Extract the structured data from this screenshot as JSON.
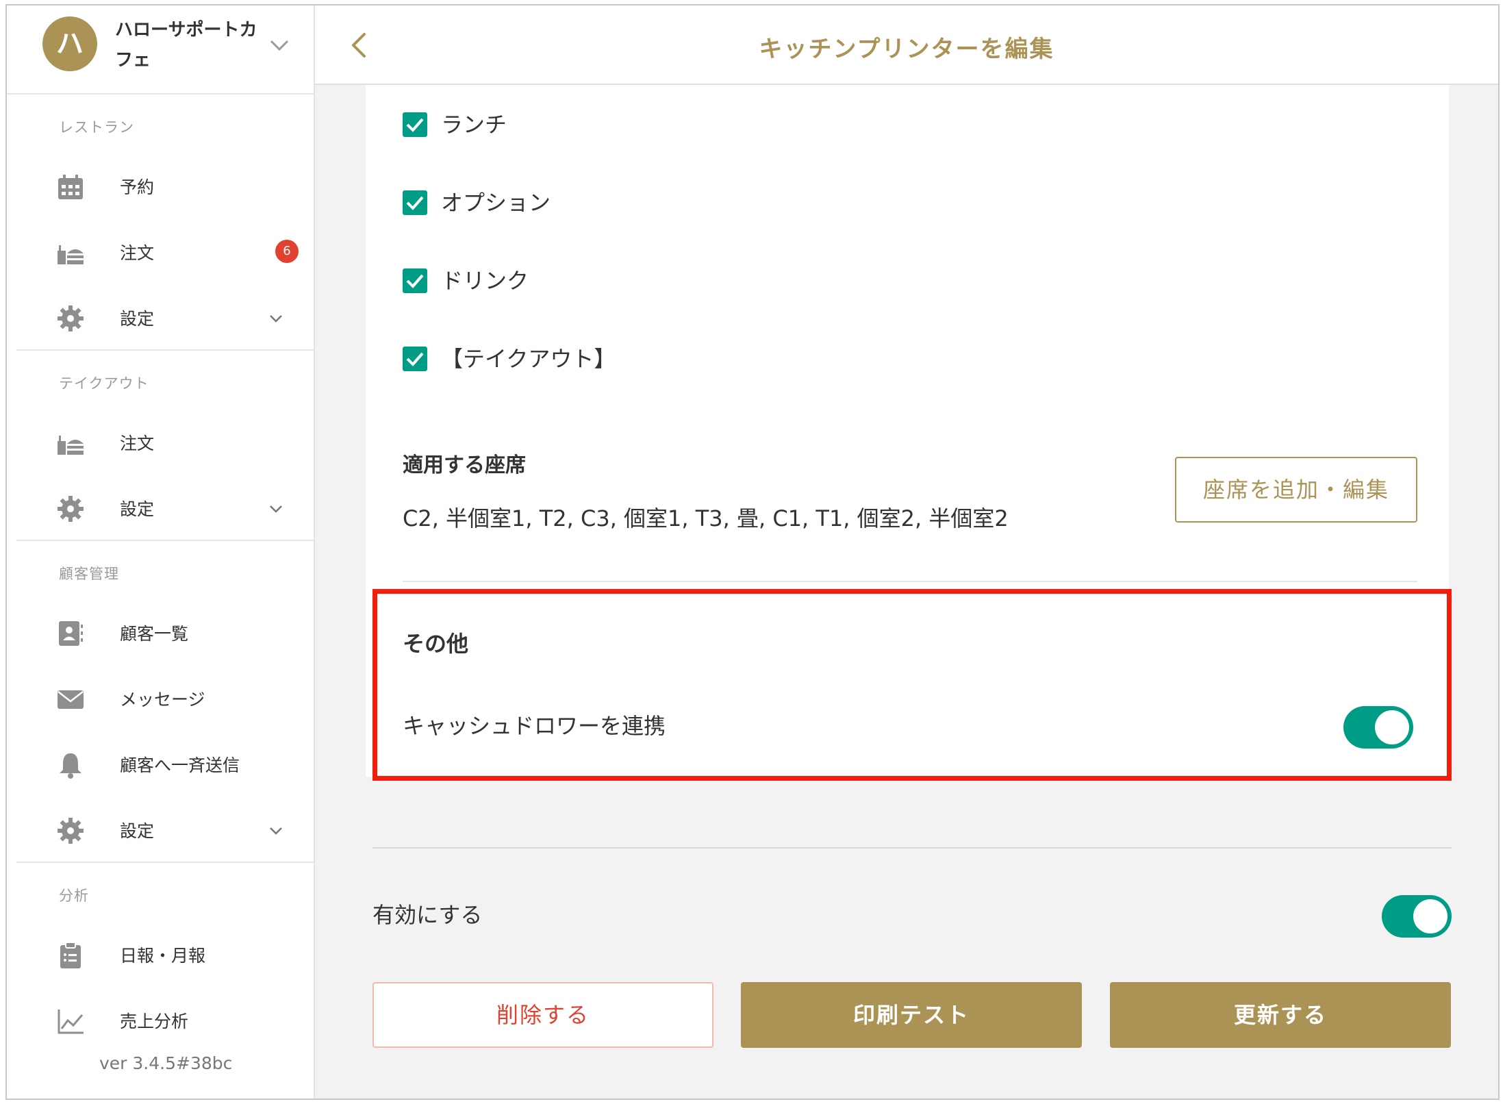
{
  "account": {
    "avatar_initial": "ハ",
    "name": "ハローサポートカフェ"
  },
  "sidebar": {
    "sections": [
      {
        "label": "レストラン",
        "items": [
          {
            "label": "予約",
            "icon": "calendar-icon"
          },
          {
            "label": "注文",
            "icon": "order-tray-icon",
            "badge": "6"
          },
          {
            "label": "設定",
            "icon": "gear-icon",
            "expandable": true
          }
        ]
      },
      {
        "label": "テイクアウト",
        "items": [
          {
            "label": "注文",
            "icon": "order-tray-icon"
          },
          {
            "label": "設定",
            "icon": "gear-icon",
            "expandable": true
          }
        ]
      },
      {
        "label": "顧客管理",
        "items": [
          {
            "label": "顧客一覧",
            "icon": "contact-book-icon"
          },
          {
            "label": "メッセージ",
            "icon": "envelope-icon"
          },
          {
            "label": "顧客へ一斉送信",
            "icon": "bell-icon"
          },
          {
            "label": "設定",
            "icon": "gear-icon",
            "expandable": true
          }
        ]
      },
      {
        "label": "分析",
        "items": [
          {
            "label": "日報・月報",
            "icon": "clipboard-icon"
          },
          {
            "label": "売上分析",
            "icon": "line-chart-icon"
          }
        ]
      }
    ],
    "version": "ver 3.4.5#38bc"
  },
  "header": {
    "title": "キッチンプリンターを編集"
  },
  "categories": [
    {
      "label": "ランチ",
      "checked": true
    },
    {
      "label": "オプション",
      "checked": true
    },
    {
      "label": "ドリンク",
      "checked": true
    },
    {
      "label": "【テイクアウト】",
      "checked": true
    }
  ],
  "seats": {
    "title": "適用する座席",
    "list": "C2, 半個室1, T2, C3, 個室1, T3, 畳, C1, T1, 個室2, 半個室2",
    "edit_button": "座席を追加・編集"
  },
  "other": {
    "title": "その他",
    "cash_drawer_label": "キャッシュドロワーを連携",
    "cash_drawer_enabled": true
  },
  "enable": {
    "label": "有効にする",
    "enabled": true
  },
  "actions": {
    "delete": "削除する",
    "print_test": "印刷テスト",
    "update": "更新する"
  },
  "colors": {
    "brand_gold": "#ab9356",
    "accent_teal": "#009d86",
    "danger_red": "#e2412f",
    "highlight_red": "#f01e0a"
  }
}
